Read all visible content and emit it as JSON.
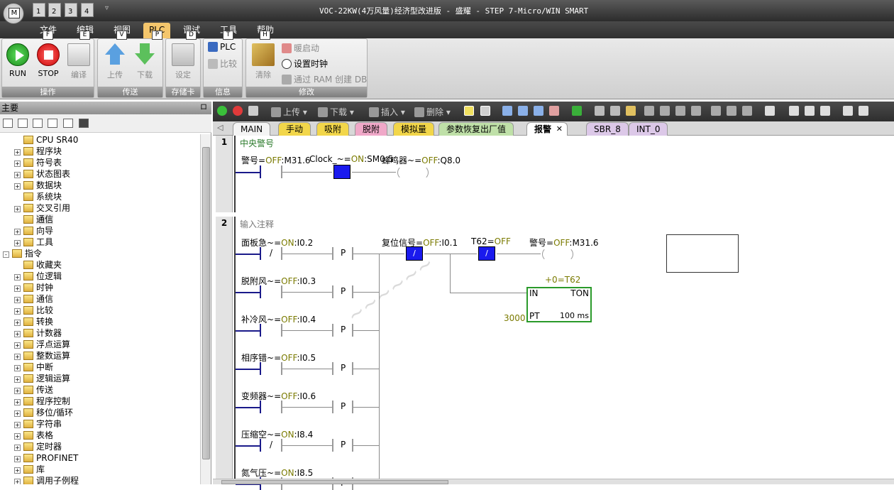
{
  "title": "VOC-22KW(4万风量)经济型改进版 - 盛耀 - STEP 7-Micro/WIN SMART",
  "app_icon_letter": "M",
  "qat": [
    "1",
    "2",
    "3",
    "4"
  ],
  "menus": [
    {
      "label": "文件",
      "key": "F"
    },
    {
      "label": "编辑",
      "key": "E"
    },
    {
      "label": "视图",
      "key": "V"
    },
    {
      "label": "PLC",
      "key": "P"
    },
    {
      "label": "调试",
      "key": "D"
    },
    {
      "label": "工具",
      "key": "T"
    },
    {
      "label": "帮助",
      "key": "H"
    }
  ],
  "ribbon": {
    "groups": [
      "操作",
      "传送",
      "存储卡",
      "信息",
      "修改"
    ],
    "run": "RUN",
    "stop": "STOP",
    "compile": "编译",
    "upload": "上传",
    "download": "下载",
    "setup": "设定",
    "plc": "PLC",
    "compare": "比较",
    "clear": "清除",
    "warm_start": "暖启动",
    "set_clock": "设置时钟",
    "create_db": "通过 RAM 创建 DB"
  },
  "left": {
    "title": "主要",
    "pin": "ロ",
    "tree": [
      {
        "label": "CPU SR40",
        "level": 1,
        "pm": ""
      },
      {
        "label": "程序块",
        "level": 1,
        "pm": "+"
      },
      {
        "label": "符号表",
        "level": 1,
        "pm": "+"
      },
      {
        "label": "状态图表",
        "level": 1,
        "pm": "+"
      },
      {
        "label": "数据块",
        "level": 1,
        "pm": "+"
      },
      {
        "label": "系统块",
        "level": 1,
        "pm": ""
      },
      {
        "label": "交叉引用",
        "level": 1,
        "pm": "+"
      },
      {
        "label": "通信",
        "level": 1,
        "pm": "",
        "sel": true
      },
      {
        "label": "向导",
        "level": 1,
        "pm": "+"
      },
      {
        "label": "工具",
        "level": 1,
        "pm": "+"
      },
      {
        "label": "指令",
        "level": 0,
        "pm": "-"
      },
      {
        "label": "收藏夹",
        "level": 1,
        "pm": ""
      },
      {
        "label": "位逻辑",
        "level": 1,
        "pm": "+"
      },
      {
        "label": "时钟",
        "level": 1,
        "pm": "+"
      },
      {
        "label": "通信",
        "level": 1,
        "pm": "+"
      },
      {
        "label": "比较",
        "level": 1,
        "pm": "+"
      },
      {
        "label": "转换",
        "level": 1,
        "pm": "+"
      },
      {
        "label": "计数器",
        "level": 1,
        "pm": "+"
      },
      {
        "label": "浮点运算",
        "level": 1,
        "pm": "+"
      },
      {
        "label": "整数运算",
        "level": 1,
        "pm": "+"
      },
      {
        "label": "中断",
        "level": 1,
        "pm": "+"
      },
      {
        "label": "逻辑运算",
        "level": 1,
        "pm": "+"
      },
      {
        "label": "传送",
        "level": 1,
        "pm": "+"
      },
      {
        "label": "程序控制",
        "level": 1,
        "pm": "+"
      },
      {
        "label": "移位/循环",
        "level": 1,
        "pm": "+"
      },
      {
        "label": "字符串",
        "level": 1,
        "pm": "+"
      },
      {
        "label": "表格",
        "level": 1,
        "pm": "+"
      },
      {
        "label": "定时器",
        "level": 1,
        "pm": "+"
      },
      {
        "label": "PROFINET",
        "level": 1,
        "pm": "+"
      },
      {
        "label": "库",
        "level": 1,
        "pm": "+"
      },
      {
        "label": "调用子例程",
        "level": 1,
        "pm": "+"
      }
    ]
  },
  "editor_tools": {
    "upload": "上传",
    "download": "下载",
    "insert": "插入",
    "delete": "删除"
  },
  "tabs": [
    "MAIN",
    "手动",
    "吸附",
    "脱附",
    "模拟量",
    "参数恢复出厂值",
    "报警",
    "SBR_8",
    "INT_0"
  ],
  "tab_close": "✕",
  "net1": {
    "no": "1",
    "comment": "中央警号",
    "c1": {
      "name": "警号",
      "eq": "=",
      "state": "OFF",
      "addr": ":M31.6"
    },
    "c2": {
      "name": "Clock_~",
      "eq": "=",
      "state": "ON",
      "addr": ":SM0.5"
    },
    "coil": {
      "name": "蜂鸣器~",
      "eq": "=",
      "state": "OFF",
      "addr": ":Q8.0"
    }
  },
  "net2": {
    "no": "2",
    "comment": "输入注释",
    "rows": [
      {
        "name": "面板急~",
        "state": "ON",
        "addr": ":I0.2",
        "neg": "/"
      },
      {
        "name": "脱附风~",
        "state": "OFF",
        "addr": ":I0.3",
        "neg": ""
      },
      {
        "name": "补冷风~",
        "state": "OFF",
        "addr": ":I0.4",
        "neg": ""
      },
      {
        "name": "相序错~",
        "state": "OFF",
        "addr": ":I0.5",
        "neg": ""
      },
      {
        "name": "变频器~",
        "state": "OFF",
        "addr": ":I0.6",
        "neg": ""
      },
      {
        "name": "压缩空~",
        "state": "ON",
        "addr": ":I8.4",
        "neg": "/"
      },
      {
        "name": "氮气压~",
        "state": "ON",
        "addr": ":I8.5",
        "neg": ""
      }
    ],
    "p": "P",
    "eq": "=",
    "reset": {
      "name": "复位信号",
      "state": "OFF",
      "addr": ":I0.1",
      "neg": "/"
    },
    "t62": {
      "name": "T62",
      "state": "OFF",
      "neg": "/"
    },
    "alarm": {
      "name": "警号",
      "state": "OFF",
      "addr": ":M31.6"
    },
    "timer": {
      "header": "+0=T62",
      "in": "IN",
      "ton": "TON",
      "pt": "PT",
      "ptval": "3000",
      "base": "100 ms"
    }
  }
}
